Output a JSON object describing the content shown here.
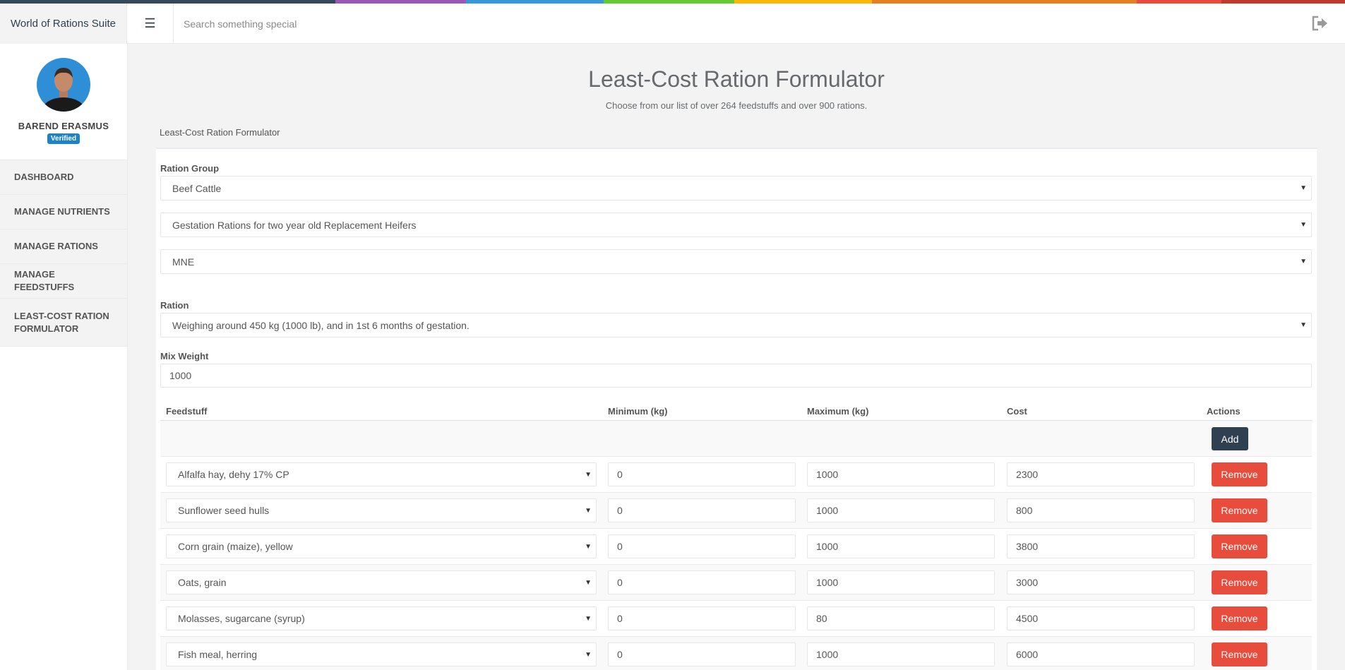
{
  "colors": {
    "rainbow": [
      "#34495e",
      "#9b59b6",
      "#3498db",
      "#62cb31",
      "#ffb606",
      "#e67e22",
      "#e74c3c",
      "#c0392b"
    ],
    "accent_dark": "#2f4050",
    "remove_red": "#e74c3c",
    "verified_blue": "#1c84c6"
  },
  "header": {
    "brand": "World of Rations Suite",
    "menu_icon": "hamburger-icon",
    "search_placeholder": "Search something special",
    "logout_icon": "sign-out-icon"
  },
  "profile": {
    "name": "BAREND ERASMUS",
    "badge": "Verified"
  },
  "nav": {
    "dashboard": "DASHBOARD",
    "nutrients": "MANAGE NUTRIENTS",
    "rations": "MANAGE RATIONS",
    "feedstuffs": "MANAGE FEEDSTUFFS",
    "formulator": "LEAST-COST RATION FORMULATOR"
  },
  "page": {
    "title": "Least-Cost Ration Formulator",
    "subtitle": "Choose from our list of over 264 feedstuffs and over 900 rations.",
    "breadcrumb": "Least-Cost Ration Formulator"
  },
  "form": {
    "ration_group_label": "Ration Group",
    "ration_group_value": "Beef Cattle",
    "subgroup_value": "Gestation Rations for two year old Replacement Heifers",
    "unit_value": "MNE",
    "ration_label": "Ration",
    "ration_value": "Weighing around 450 kg (1000 lb), and in 1st 6 months of gestation.",
    "mix_weight_label": "Mix Weight",
    "mix_weight_value": "1000"
  },
  "table": {
    "headers": {
      "feedstuff": "Feedstuff",
      "min": "Minimum (kg)",
      "max": "Maximum (kg)",
      "cost": "Cost",
      "actions": "Actions"
    },
    "add_label": "Add",
    "remove_label": "Remove",
    "rows": [
      {
        "feedstuff": "Alfalfa hay, dehy 17% CP",
        "min": "0",
        "max": "1000",
        "cost": "2300"
      },
      {
        "feedstuff": "Sunflower seed hulls",
        "min": "0",
        "max": "1000",
        "cost": "800"
      },
      {
        "feedstuff": "Corn grain (maize), yellow",
        "min": "0",
        "max": "1000",
        "cost": "3800"
      },
      {
        "feedstuff": "Oats, grain",
        "min": "0",
        "max": "1000",
        "cost": "3000"
      },
      {
        "feedstuff": "Molasses, sugarcane (syrup)",
        "min": "0",
        "max": "80",
        "cost": "4500"
      },
      {
        "feedstuff": "Fish meal, herring",
        "min": "0",
        "max": "1000",
        "cost": "6000"
      }
    ]
  }
}
